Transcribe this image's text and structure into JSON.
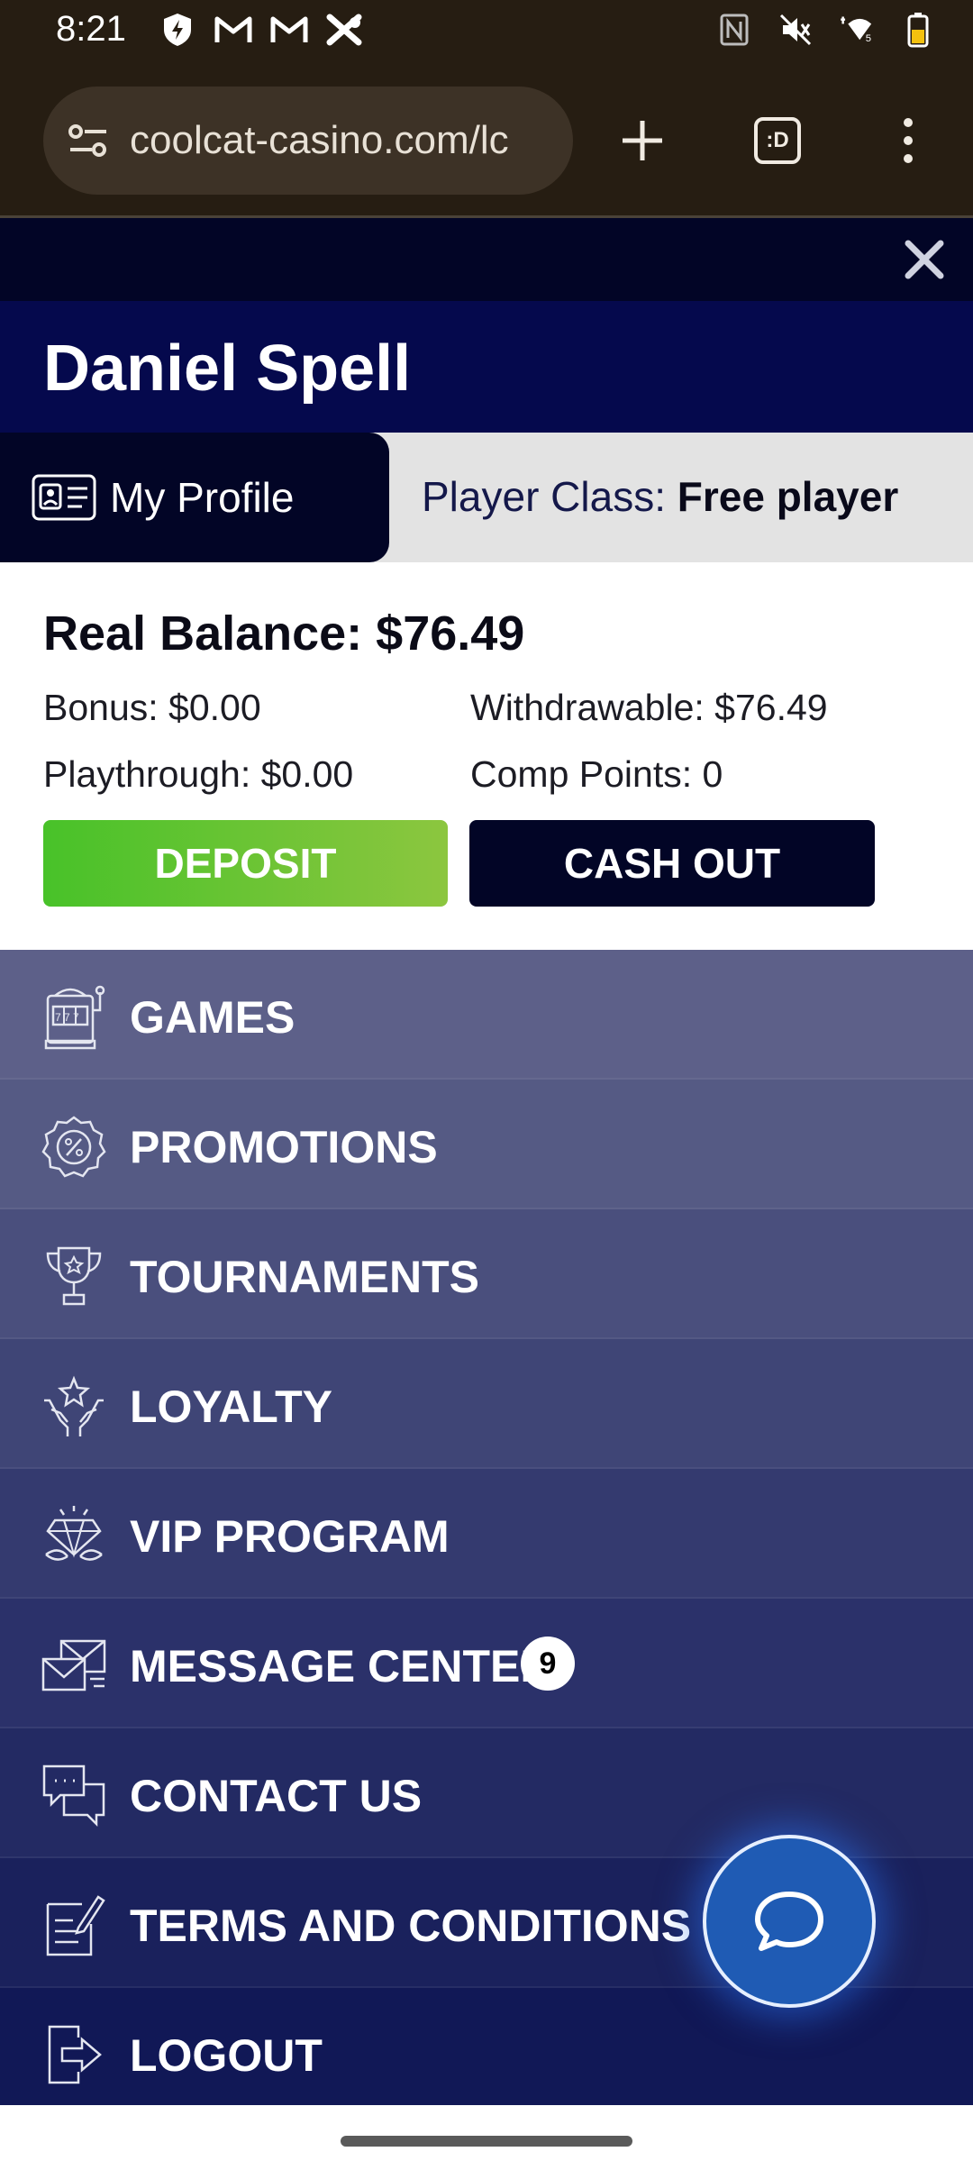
{
  "status_bar": {
    "time": "8:21",
    "left_icons": [
      "shield-bolt-icon",
      "gmail-icon",
      "gmail-icon",
      "x-app-icon"
    ],
    "right_icons": [
      "nfc-icon",
      "mute-icon",
      "wifi-icon",
      "battery-icon"
    ]
  },
  "browser": {
    "url": "coolcat-casino.com/lc",
    "tab_count_label": ":D"
  },
  "user": {
    "name": "Daniel Spell",
    "my_profile_label": "My Profile",
    "player_class_label": "Player Class:",
    "player_class_value": "Free player"
  },
  "balance": {
    "real_balance": "Real Balance: $76.49",
    "bonus": "Bonus: $0.00",
    "withdrawable": "Withdrawable: $76.49",
    "playthrough": "Playthrough: $0.00",
    "comp_points": "Comp Points: 0",
    "deposit_label": "DEPOSIT",
    "cashout_label": "CASH OUT"
  },
  "menu": [
    {
      "label": "GAMES",
      "icon": "slot-machine-icon",
      "color": "#5d6089"
    },
    {
      "label": "PROMOTIONS",
      "icon": "percent-badge-icon",
      "color": "#555a84"
    },
    {
      "label": "TOURNAMENTS",
      "icon": "trophy-icon",
      "color": "#4a4f7d"
    },
    {
      "label": "LOYALTY",
      "icon": "hands-star-icon",
      "color": "#3f4576"
    },
    {
      "label": "VIP PROGRAM",
      "icon": "diamond-icon",
      "color": "#343a6f"
    },
    {
      "label": "MESSAGE CENTER",
      "icon": "envelope-icon",
      "color": "#2b316a",
      "badge": "9"
    },
    {
      "label": "CONTACT US",
      "icon": "chat-bubbles-icon",
      "color": "#232a63"
    },
    {
      "label": "TERMS AND CONDITIONS",
      "icon": "document-edit-icon",
      "color": "#1a215c"
    },
    {
      "label": "LOGOUT",
      "icon": "logout-icon",
      "color": "#111856"
    }
  ],
  "colors": {
    "header_dark": "#020526",
    "header_navy": "#05094d",
    "deposit_green": "#5cc12f",
    "chat_blue": "#1f5bb4"
  }
}
